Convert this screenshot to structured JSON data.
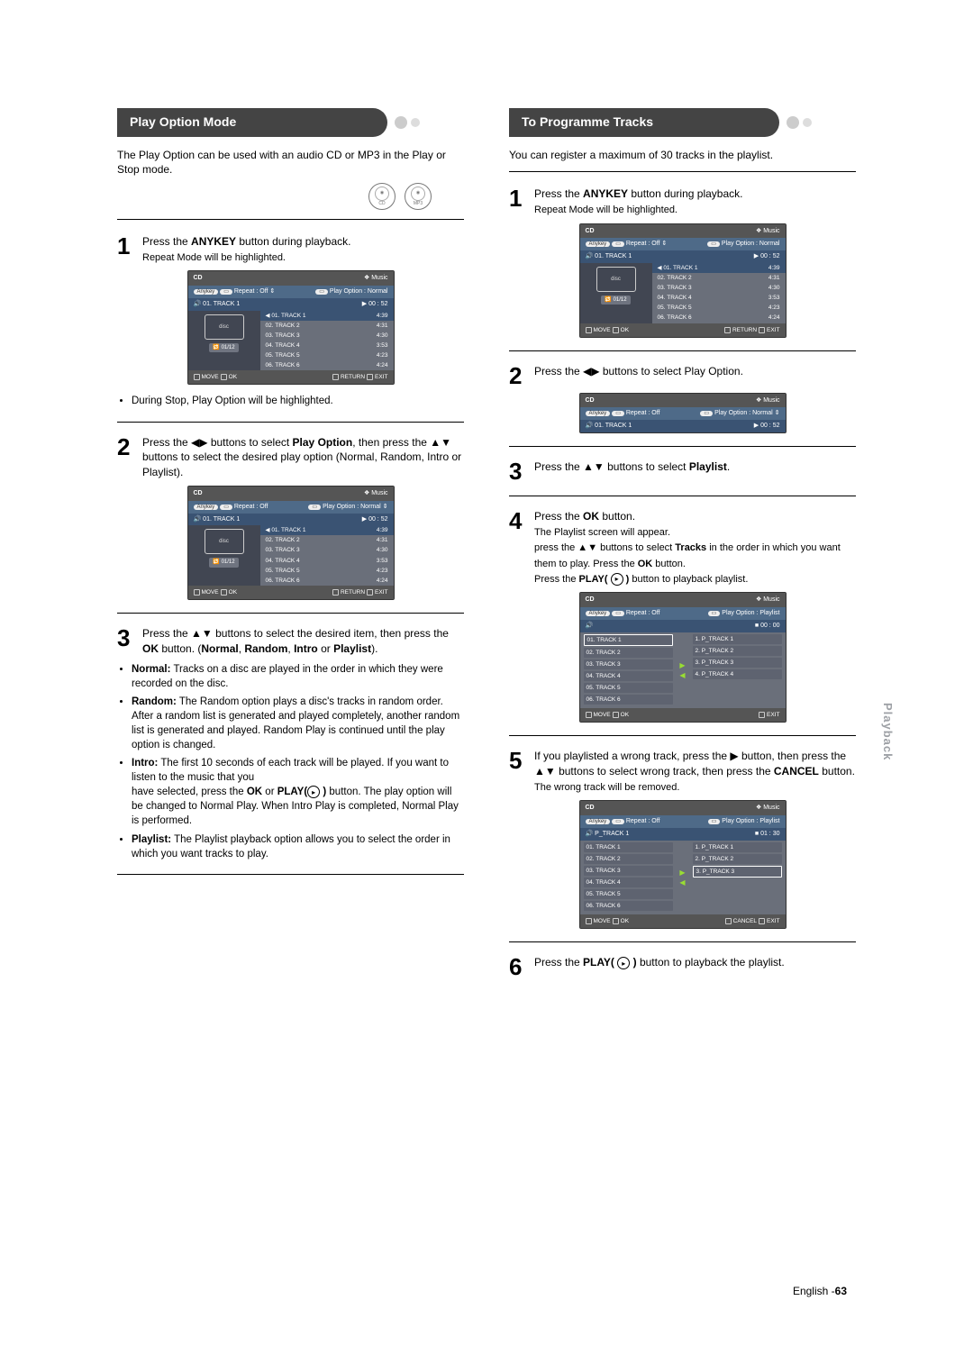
{
  "sideTab": "Playback",
  "footer": {
    "lang": "English -",
    "page": "63"
  },
  "icons": {
    "cd": "CD",
    "mp3": "MP3"
  },
  "left": {
    "title": "Play Option Mode",
    "intro": "The Play Option can be used with an audio CD or MP3 in the Play or Stop mode.",
    "step1": {
      "line1a": "Press the ",
      "bold1": "ANYKEY",
      "line1b": " button during playback.",
      "line2": "Repeat Mode will be highlighted."
    },
    "note1": "During Stop, Play Option will be highlighted.",
    "step2": {
      "t1": "Press the ◀▶ buttons to select ",
      "b1": "Play Option",
      "t2": ", then press the ▲▼ buttons to select the desired play option (Normal, Random, Intro or Playlist)."
    },
    "step3": {
      "t": "Press the ▲▼ buttons to select the desired item, then press the ",
      "b1": "OK",
      "m": " button. (",
      "b2": "Normal",
      "sep1": ", ",
      "b3": "Random",
      "sep2": ", ",
      "b4": "Intro",
      "sep3": " or ",
      "b5": "Playlist",
      "end": ")."
    },
    "bullets": {
      "normalLabel": "Normal:",
      "normal": " Tracks on a disc are played in the order in which they were recorded on the disc.",
      "randomLabel": "Random:",
      "random": " The Random option plays a disc's tracks in random order. After a random list is generated and played completely, another random list is generated and played. Random Play is continued until the play option is changed.",
      "introLabel": "Intro:",
      "intro1": " The first 10 seconds of each track will be played. If you want to listen to the music that you",
      "intro2a": "have selected, press the ",
      "intro2b": "OK",
      "intro2c": " or ",
      "intro2d": "PLAY(",
      "intro2e": " )",
      "intro2f": " button. The play option will be changed to Normal Play. When Intro Play is completed, Normal Play is performed.",
      "playlistLabel": "Playlist:",
      "playlist": " The Playlist playback option allows you to select the order in which you want tracks to play."
    },
    "osd": {
      "hdrL": "CD",
      "hdrR": "❖ Music",
      "repeat": "Repeat : Off",
      "playopt": "Play Option : Normal",
      "cur": "01. TRACK 1",
      "time": "00 : 52",
      "rt": "01/12",
      "tracks": [
        {
          "n": "01. TRACK 1",
          "t": "4:39"
        },
        {
          "n": "02. TRACK 2",
          "t": "4:31"
        },
        {
          "n": "03. TRACK 3",
          "t": "4:30"
        },
        {
          "n": "04. TRACK 4",
          "t": "3:53"
        },
        {
          "n": "05. TRACK 5",
          "t": "4:23"
        },
        {
          "n": "06. TRACK 6",
          "t": "4:24"
        }
      ],
      "ft": {
        "move": "MOVE",
        "ok": "OK",
        "ret": "RETURN",
        "exit": "EXIT"
      }
    }
  },
  "right": {
    "title": "To Programme Tracks",
    "intro": "You can register a maximum of 30 tracks in the playlist.",
    "step1": {
      "line1a": "Press the ",
      "bold1": "ANYKEY",
      "line1b": " button during playback.",
      "line2": "Repeat Mode will be highlighted."
    },
    "step2": {
      "t": "Press the ◀▶ buttons to select Play Option."
    },
    "step3": {
      "t1": "Press the ▲▼ buttons to select ",
      "b": "Playlist",
      "t2": "."
    },
    "step4": {
      "l1a": "Press the ",
      "b1": "OK",
      "l1b": " button.",
      "l2": "The Playlist screen will appear.",
      "l3a": "press the ▲▼ buttons to select ",
      "b2": "Tracks",
      "l3b": " in the order in which you want them to play. Press the ",
      "b3": "OK",
      "l3c": " button.",
      "l4a": "Press the ",
      "b4": "PLAY( ",
      "l4b": " )",
      "l4c": " button to playback playlist."
    },
    "step5": {
      "t1": "If you playlisted a wrong track, press the ▶ button, then press the ▲▼ buttons to select wrong track, then press the ",
      "b": "CANCEL",
      "t2": " button.",
      "l2": "The wrong track will be removed."
    },
    "step6": {
      "t1": "Press the ",
      "b": "PLAY( ",
      "t2": " )",
      "t3": " button to playback the playlist."
    },
    "osd1": {
      "hdrL": "CD",
      "hdrR": "❖ Music",
      "repeat": "Repeat : Off",
      "playopt": "Play Option : Normal",
      "cur": "01. TRACK 1",
      "time": "00 : 52",
      "rt": "01/12",
      "tracks": [
        {
          "n": "01. TRACK 1",
          "t": "4:39"
        },
        {
          "n": "02. TRACK 2",
          "t": "4:31"
        },
        {
          "n": "03. TRACK 3",
          "t": "4:30"
        },
        {
          "n": "04. TRACK 4",
          "t": "3:53"
        },
        {
          "n": "05. TRACK 5",
          "t": "4:23"
        },
        {
          "n": "06. TRACK 6",
          "t": "4:24"
        }
      ]
    },
    "osd2": {
      "hdrL": "CD",
      "hdrR": "❖ Music",
      "repeat": "Repeat : Off",
      "playopt": "Play Option : Normal",
      "cur": "01. TRACK 1",
      "time": "00 : 52"
    },
    "osd3": {
      "hdrL": "CD",
      "hdrR": "❖ Music",
      "repeat": "Repeat : Off",
      "playopt": "Play Option : Playlist",
      "cur": "",
      "time": "00 : 00",
      "left": [
        "01. TRACK 1",
        "02. TRACK 2",
        "03. TRACK 3",
        "04. TRACK 4",
        "05. TRACK 5",
        "06. TRACK 6"
      ],
      "right": [
        "1. P_TRACK 1",
        "2. P_TRACK 2",
        "3. P_TRACK 3",
        "4. P_TRACK 4"
      ]
    },
    "osd4": {
      "hdrL": "CD",
      "hdrR": "❖ Music",
      "repeat": "Repeat : Off",
      "playopt": "Play Option : Playlist",
      "cur": "P_TRACK 1",
      "time": "01 : 30",
      "left": [
        "01. TRACK 1",
        "02. TRACK 2",
        "03. TRACK 3",
        "04. TRACK 4",
        "05. TRACK 5",
        "06. TRACK 6"
      ],
      "right": [
        "1. P_TRACK 1",
        "2. P_TRACK 2",
        "3. P_TRACK 3"
      ],
      "ft": {
        "move": "MOVE",
        "ok": "OK",
        "cancel": "CANCEL",
        "exit": "EXIT"
      }
    },
    "ft": {
      "move": "MOVE",
      "ok": "OK",
      "ret": "RETURN",
      "exit": "EXIT"
    }
  }
}
